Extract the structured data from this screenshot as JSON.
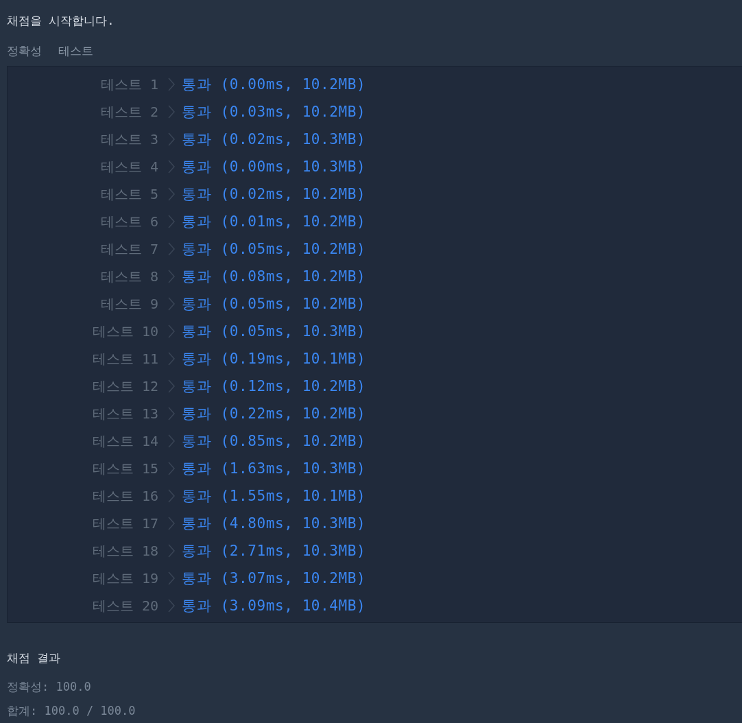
{
  "header": "채점을 시작합니다.",
  "section_title": "정확성 테스트",
  "tests": [
    {
      "label": "테스트 1",
      "result": "통과 (0.00ms, 10.2MB)"
    },
    {
      "label": "테스트 2",
      "result": "통과 (0.03ms, 10.2MB)"
    },
    {
      "label": "테스트 3",
      "result": "통과 (0.02ms, 10.3MB)"
    },
    {
      "label": "테스트 4",
      "result": "통과 (0.00ms, 10.3MB)"
    },
    {
      "label": "테스트 5",
      "result": "통과 (0.02ms, 10.2MB)"
    },
    {
      "label": "테스트 6",
      "result": "통과 (0.01ms, 10.2MB)"
    },
    {
      "label": "테스트 7",
      "result": "통과 (0.05ms, 10.2MB)"
    },
    {
      "label": "테스트 8",
      "result": "통과 (0.08ms, 10.2MB)"
    },
    {
      "label": "테스트 9",
      "result": "통과 (0.05ms, 10.2MB)"
    },
    {
      "label": "테스트 10",
      "result": "통과 (0.05ms, 10.3MB)"
    },
    {
      "label": "테스트 11",
      "result": "통과 (0.19ms, 10.1MB)"
    },
    {
      "label": "테스트 12",
      "result": "통과 (0.12ms, 10.2MB)"
    },
    {
      "label": "테스트 13",
      "result": "통과 (0.22ms, 10.2MB)"
    },
    {
      "label": "테스트 14",
      "result": "통과 (0.85ms, 10.2MB)"
    },
    {
      "label": "테스트 15",
      "result": "통과 (1.63ms, 10.3MB)"
    },
    {
      "label": "테스트 16",
      "result": "통과 (1.55ms, 10.1MB)"
    },
    {
      "label": "테스트 17",
      "result": "통과 (4.80ms, 10.3MB)"
    },
    {
      "label": "테스트 18",
      "result": "통과 (2.71ms, 10.3MB)"
    },
    {
      "label": "테스트 19",
      "result": "통과 (3.07ms, 10.2MB)"
    },
    {
      "label": "테스트 20",
      "result": "통과 (3.09ms, 10.4MB)"
    }
  ],
  "summary": {
    "title": "채점 결과",
    "lines": [
      "정확성: 100.0",
      "합계: 100.0 / 100.0"
    ]
  }
}
